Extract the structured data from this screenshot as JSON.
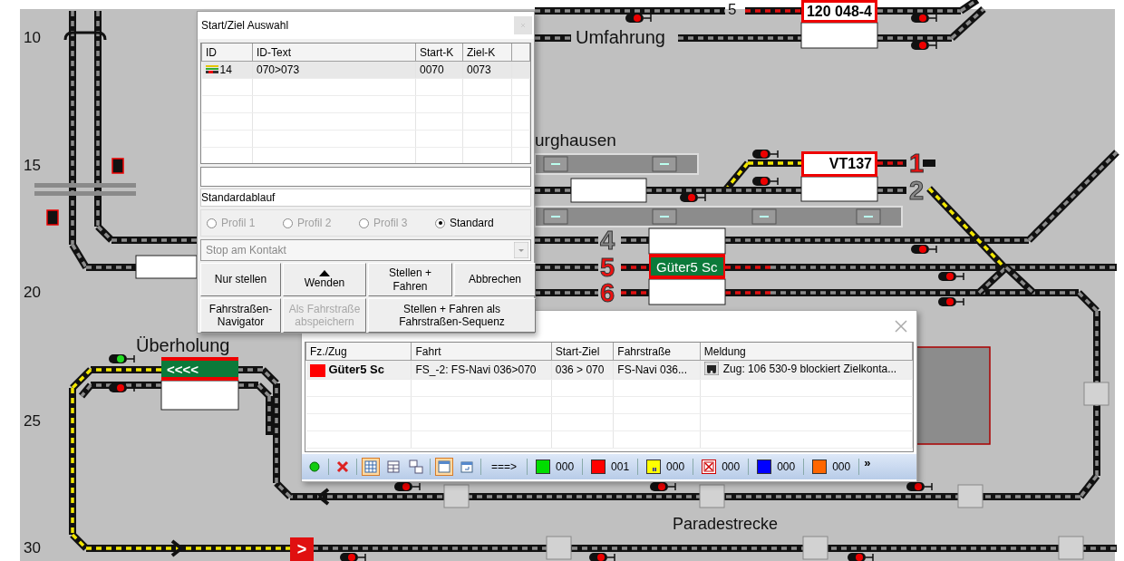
{
  "track_plan": {
    "row_numbers": [
      "10",
      "15",
      "20",
      "25",
      "30"
    ],
    "place_labels": [
      "Umfahrung",
      "urghausen",
      "Überholung",
      "Paradestrecke"
    ],
    "cut_track_number": "5",
    "track_numbers": [
      {
        "text": "1",
        "color": "#ee1111"
      },
      {
        "text": "2",
        "color": "#888888"
      },
      {
        "text": "4",
        "color": "#888888"
      },
      {
        "text": "5",
        "color": "#ee1111"
      },
      {
        "text": "6",
        "color": "#ee1111"
      }
    ],
    "train_blocks": [
      {
        "text": "120 048-4",
        "kind": "reserved"
      },
      {
        "text": "VT137",
        "kind": "reserved"
      },
      {
        "text": "Güter5 Sc",
        "kind": "occupied"
      },
      {
        "text": "<<<<",
        "kind": "occupied"
      }
    ],
    "direction_marker": ">"
  },
  "route_dialog": {
    "title": "Start/Ziel Auswahl",
    "columns": [
      "ID",
      "ID-Text",
      "Start-K",
      "Ziel-K"
    ],
    "rows": [
      {
        "id": "14",
        "text": "070>073",
        "start": "0070",
        "end": "0073",
        "selected": true
      }
    ],
    "sequence": "Standardablauf",
    "profiles": [
      {
        "label": "Profil 1",
        "selected": false,
        "disabled": true
      },
      {
        "label": "Profil 2",
        "selected": false,
        "disabled": true
      },
      {
        "label": "Profil 3",
        "selected": false,
        "disabled": true
      },
      {
        "label": "Standard",
        "selected": true,
        "disabled": false
      }
    ],
    "stop_mode": {
      "value": "Stop am Kontakt",
      "disabled": true
    },
    "buttons": [
      {
        "label": "Nur stellen",
        "kind": "plain",
        "disabled": false
      },
      {
        "label": "Wenden",
        "kind": "arrow",
        "disabled": false
      },
      {
        "label": "Stellen + Fahren",
        "kind": "plain",
        "disabled": false
      },
      {
        "label": "Abbrechen",
        "kind": "plain",
        "disabled": false
      },
      {
        "label": "Fahrstraßen-Navigator",
        "kind": "plain",
        "disabled": false
      },
      {
        "label": "Als Fahrstraße abspeichern",
        "kind": "plain",
        "disabled": true
      },
      {
        "label": "Stellen + Fahren als Fahrstraßen-Sequenz",
        "kind": "plain",
        "disabled": false
      }
    ]
  },
  "train_dialog": {
    "columns": [
      "Fz./Zug",
      "Fahrt",
      "Start-Ziel",
      "Fahrstraße",
      "Meldung"
    ],
    "rows": [
      {
        "color": "#ff0000",
        "train": "Güter5 Sc",
        "trip": "FS_-2: FS-Navi 036>070",
        "start_end": "036 > 070",
        "route": "FS-Navi 036...",
        "message": "Zug: 106 530-9 blockiert Zielkonta...",
        "selected": true
      }
    ],
    "toolbar": {
      "view_buttons": [
        {
          "selected": true
        },
        {
          "selected": false
        },
        {
          "selected": false
        }
      ],
      "window_buttons": [
        {
          "selected": true
        },
        {
          "selected": false
        }
      ],
      "arrow_label": "===>",
      "counters": [
        {
          "color": "#00dd00",
          "kind": "plain",
          "count": "000"
        },
        {
          "color": "#ff0000",
          "kind": "plain",
          "count": "001"
        },
        {
          "color": "#ffff00",
          "kind": "paused",
          "count": "000"
        },
        {
          "color": "#ffffff",
          "kind": "blocked",
          "count": "000"
        },
        {
          "color": "#0000ff",
          "kind": "plain",
          "count": "000"
        },
        {
          "color": "#ff6600",
          "kind": "plain",
          "count": "000"
        }
      ],
      "more": "»"
    }
  }
}
